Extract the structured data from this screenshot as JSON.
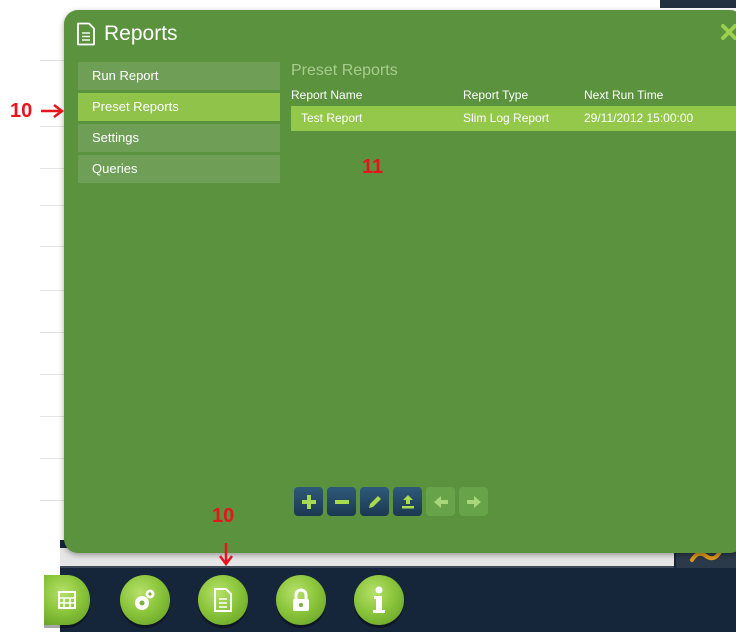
{
  "dialog": {
    "title": "Reports",
    "close_icon": "close-icon",
    "title_icon": "report-document-icon"
  },
  "nav": {
    "items": [
      {
        "label": "Run Report",
        "active": false
      },
      {
        "label": "Preset Reports",
        "active": true
      },
      {
        "label": "Settings",
        "active": false
      },
      {
        "label": "Queries",
        "active": false
      }
    ]
  },
  "content": {
    "section_title": "Preset Reports",
    "columns": [
      "Report Name",
      "Report Type",
      "Next Run Time"
    ],
    "rows": [
      {
        "name": "Test Report",
        "type": "Slim Log Report",
        "next_run": "29/11/2012 15:00:00",
        "selected": true
      }
    ]
  },
  "toolbar": {
    "buttons": [
      {
        "icon": "add-icon",
        "enabled": true
      },
      {
        "icon": "remove-icon",
        "enabled": true
      },
      {
        "icon": "edit-pencil-icon",
        "enabled": true
      },
      {
        "icon": "upload-icon",
        "enabled": true
      },
      {
        "icon": "arrow-left-icon",
        "enabled": false
      },
      {
        "icon": "arrow-right-icon",
        "enabled": false
      }
    ]
  },
  "dock": {
    "buttons": [
      "calculator-icon",
      "settings-gears-icon",
      "reports-document-icon",
      "lock-icon",
      "info-icon"
    ]
  },
  "annotations": {
    "label_nav": "10",
    "label_table": "11",
    "label_dock": "10"
  },
  "colors": {
    "dialog_bg": "#5a923d",
    "active_nav": "#8fc34a",
    "selected_row": "#93c84a",
    "annotation_red": "#e8141c"
  }
}
